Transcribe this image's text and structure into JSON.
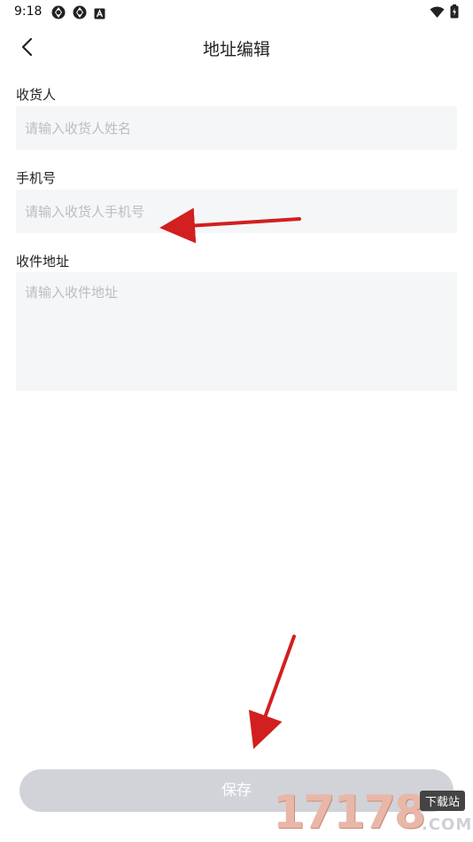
{
  "status_bar": {
    "time": "9:18",
    "left_icons": [
      "app-icon",
      "app-icon",
      "a-badge-icon"
    ],
    "right_icons": [
      "wifi-icon",
      "battery-icon"
    ]
  },
  "header": {
    "title": "地址编辑",
    "back_icon": "chevron-left-icon"
  },
  "form": {
    "name": {
      "label": "收货人",
      "placeholder": "请输入收货人姓名",
      "value": ""
    },
    "phone": {
      "label": "手机号",
      "placeholder": "请输入收货人手机号",
      "value": ""
    },
    "address": {
      "label": "收件地址",
      "placeholder": "请输入收件地址",
      "value": ""
    }
  },
  "save_label": "保存",
  "watermark": {
    "digits": "17178",
    "badge": "下载站",
    "suffix": ".COM"
  },
  "colors": {
    "input_bg": "#f5f6f8",
    "button_disabled": "#d1d3d8",
    "arrow": "#d21f1f",
    "placeholder": "#bdbdbd"
  }
}
